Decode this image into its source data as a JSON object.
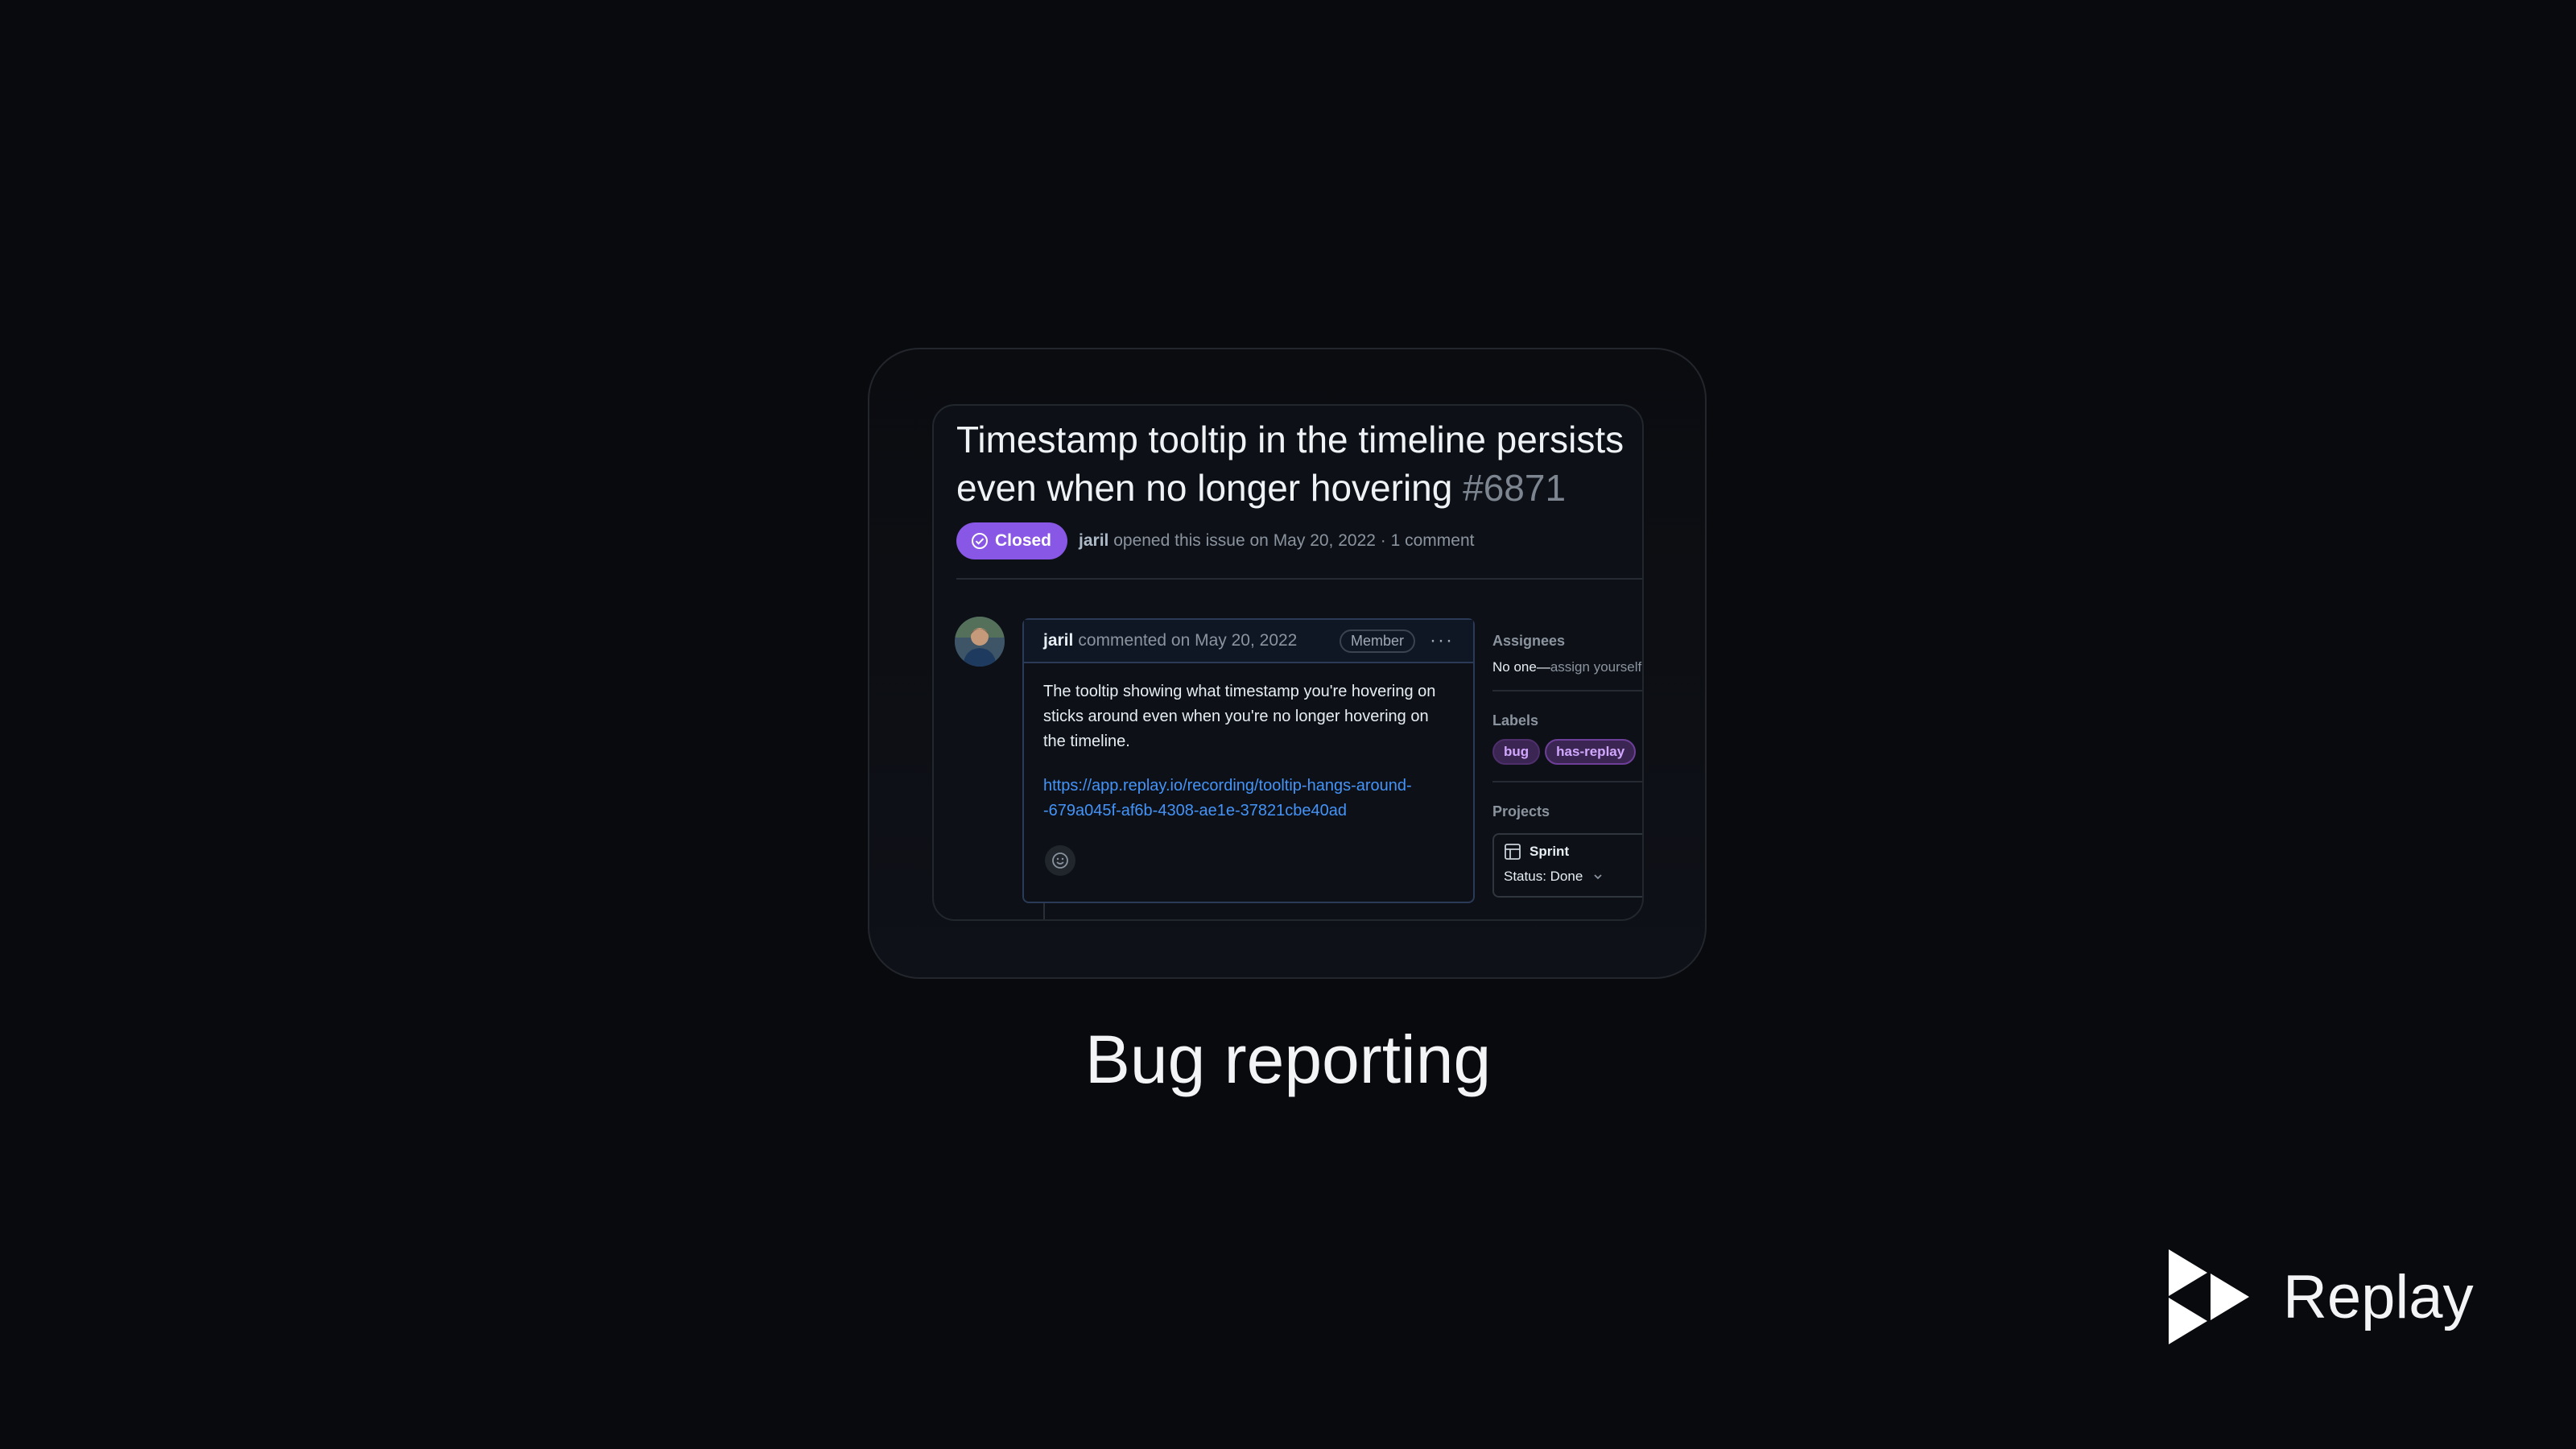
{
  "issue": {
    "title": "Timestamp tooltip in the timeline persists even when no longer hovering",
    "number": "#6871",
    "status": "Closed",
    "author": "jaril",
    "meta_text": "opened this issue on May 20, 2022 · 1 comment"
  },
  "comment": {
    "author": "jaril",
    "meta": "commented on May 20, 2022",
    "role_badge": "Member",
    "more_icon": "kebab-horizontal-icon",
    "body": "The tooltip showing what timestamp you're hovering on sticks around even when you're no longer hovering on the timeline.",
    "link": "https://app.replay.io/recording/tooltip-hangs-around-679a045f-af6b-4308-ae1e-37821cbe40ad",
    "link_line1": "https://app.replay.io/recording/tooltip-hangs-around-",
    "link_line2": "-679a045f-af6b-4308-ae1e-37821cbe40ad",
    "reaction_icon": "smiley-icon"
  },
  "sidebar": {
    "assignees_label": "Assignees",
    "assignees_value": "No one—",
    "assignees_action": "assign yourself",
    "labels_label": "Labels",
    "labels": [
      "bug",
      "has-replay"
    ],
    "projects_label": "Projects",
    "project_name": "Sprint",
    "project_status": "Status: Done"
  },
  "caption": "Bug reporting",
  "brand": {
    "name": "Replay",
    "logo_icon": "replay-logo-icon"
  },
  "colors": {
    "background": "#090a0d",
    "closed_badge": "#8957e5",
    "link": "#4493f8",
    "label_text": "#d2a8ff"
  }
}
